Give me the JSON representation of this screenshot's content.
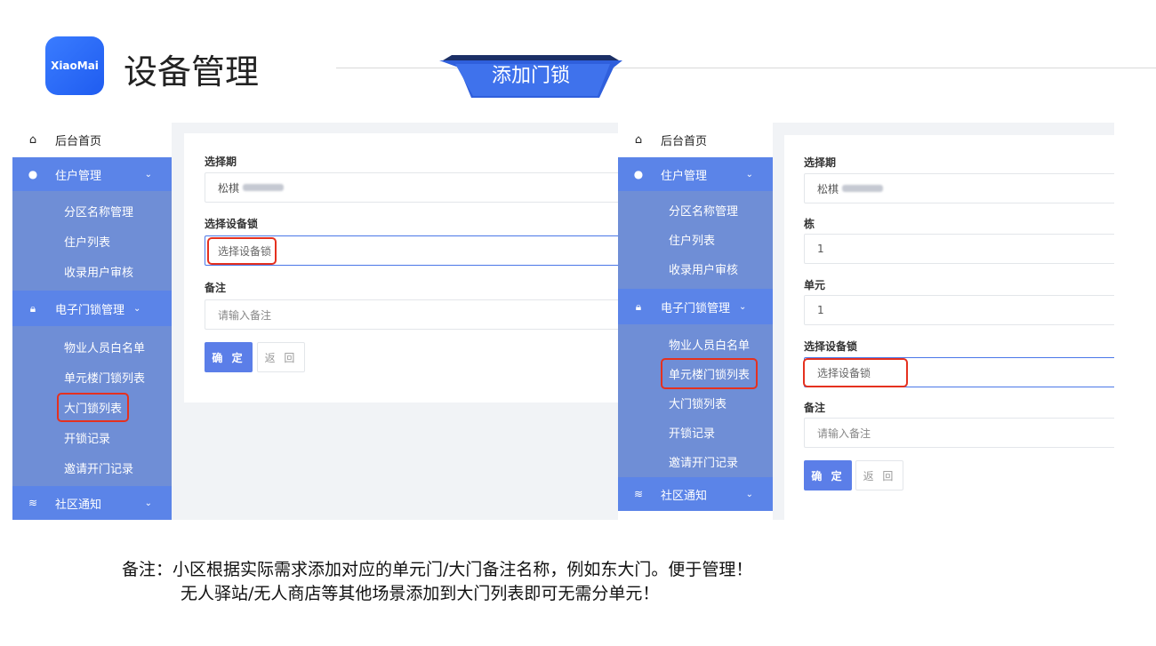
{
  "header": {
    "logo_text": "XiaoMai",
    "title": "设备管理",
    "section": "添加门锁"
  },
  "colors": {
    "accent": "#5b84e8",
    "submenu": "#6f8ed6",
    "highlight": "#e5311f",
    "banner": "#3568e6"
  },
  "sidebar_left": {
    "home": "后台首页",
    "group1": "住户管理",
    "group1_items": [
      "分区名称管理",
      "住户列表",
      "收录用户审核"
    ],
    "group2": "电子门锁管理",
    "group2_items": [
      "物业人员白名单",
      "单元楼门锁列表",
      "大门锁列表",
      "开锁记录",
      "邀请开门记录"
    ],
    "group3": "社区通知"
  },
  "form_left": {
    "period_label": "选择期",
    "period_value": "松棋",
    "lock_label": "选择设备锁",
    "lock_placeholder": "选择设备锁",
    "remark_label": "备注",
    "remark_placeholder": "请输入备注",
    "ok": "确 定",
    "back": "返 回"
  },
  "sidebar_right": {
    "home": "后台首页",
    "group1": "住户管理",
    "group1_items": [
      "分区名称管理",
      "住户列表",
      "收录用户审核"
    ],
    "group2": "电子门锁管理",
    "group2_items": [
      "物业人员白名单",
      "单元楼门锁列表",
      "大门锁列表",
      "开锁记录",
      "邀请开门记录"
    ],
    "group3": "社区通知"
  },
  "form_right": {
    "period_label": "选择期",
    "period_value": "松棋",
    "building_label": "栋",
    "building_value": "1",
    "unit_label": "单元",
    "unit_value": "1",
    "lock_label": "选择设备锁",
    "lock_placeholder": "选择设备锁",
    "remark_label": "备注",
    "remark_placeholder": "请输入备注",
    "ok": "确 定",
    "back": "返 回"
  },
  "notes": {
    "line1": "备注：小区根据实际需求添加对应的单元门/大门备注名称，例如东大门。便于管理！",
    "line2": "无人驿站/无人商店等其他场景添加到大门列表即可无需分单元！"
  }
}
